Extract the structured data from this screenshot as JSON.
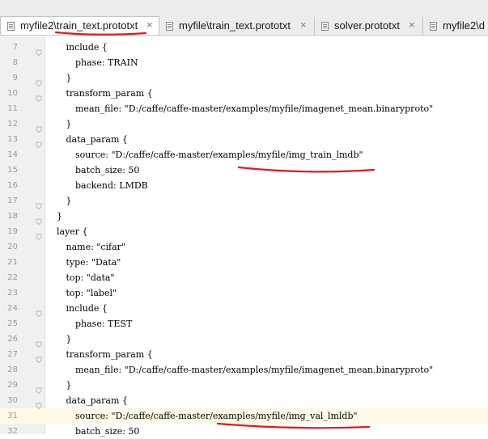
{
  "tabs": [
    {
      "label": "myfile2\\train_text.prototxt",
      "close": "×"
    },
    {
      "label": "myfile\\train_text.prototxt",
      "close": "×"
    },
    {
      "label": "solver.prototxt",
      "close": "×"
    },
    {
      "label": "myfile2\\d",
      "close": ""
    }
  ],
  "lines": [
    {
      "n": "7",
      "text": "include {"
    },
    {
      "n": "8",
      "text": "phase: TRAIN"
    },
    {
      "n": "9",
      "text": "}"
    },
    {
      "n": "10",
      "text": "transform_param {"
    },
    {
      "n": "11",
      "text": "mean_file: \"D:/caffe/caffe-master/examples/myfile/imagenet_mean.binaryproto\""
    },
    {
      "n": "12",
      "text": "}"
    },
    {
      "n": "13",
      "text": "data_param {"
    },
    {
      "n": "14",
      "text": "source: \"D:/caffe/caffe-master/examples/myfile/img_train_lmdb\""
    },
    {
      "n": "15",
      "text": "batch_size: 50"
    },
    {
      "n": "16",
      "text": "backend: LMDB"
    },
    {
      "n": "17",
      "text": "}"
    },
    {
      "n": "18",
      "text": "}"
    },
    {
      "n": "19",
      "text": "layer {"
    },
    {
      "n": "20",
      "text": "name: \"cifar\""
    },
    {
      "n": "21",
      "text": "type: \"Data\""
    },
    {
      "n": "22",
      "text": "top: \"data\""
    },
    {
      "n": "23",
      "text": "top: \"label\""
    },
    {
      "n": "24",
      "text": "include {"
    },
    {
      "n": "25",
      "text": "phase: TEST"
    },
    {
      "n": "26",
      "text": "}"
    },
    {
      "n": "27",
      "text": "transform_param {"
    },
    {
      "n": "28",
      "text": "mean_file: \"D:/caffe/caffe-master/examples/myfile/imagenet_mean.binaryproto\""
    },
    {
      "n": "29",
      "text": "}"
    },
    {
      "n": "30",
      "text": "data_param {"
    },
    {
      "n": "31",
      "text": "source: \"D:/caffe/caffe-master/examples/myfile/img_val_lmldb\""
    },
    {
      "n": "32",
      "text": "batch_size: 50"
    }
  ],
  "colors": {
    "annotation": "#e8161b",
    "current_line": "#fdfbe6",
    "gutter": "#f0f0f0"
  },
  "icons": {
    "tab_file": "file-icon",
    "fold": "fold-marker-icon"
  }
}
